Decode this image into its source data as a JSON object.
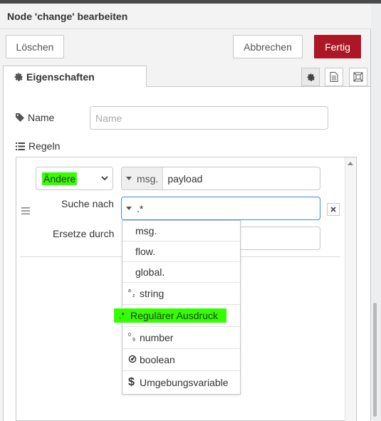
{
  "dialog": {
    "title": "Node 'change' bearbeiten"
  },
  "buttons": {
    "delete": "Löschen",
    "cancel": "Abbrechen",
    "done": "Fertig"
  },
  "tabs": {
    "properties": "Eigenschaften"
  },
  "form": {
    "name_label": "Name",
    "name_placeholder": "Name",
    "name_value": "",
    "rules_label": "Regeln"
  },
  "rule": {
    "action": "Ändere",
    "target_type": "msg.",
    "target_value": "payload",
    "search_label": "Suche nach",
    "search_type": ".*",
    "search_value": "",
    "replace_label": "Ersetze durch"
  },
  "type_menu": [
    {
      "label": "msg.",
      "icon": ""
    },
    {
      "label": "flow.",
      "icon": ""
    },
    {
      "label": "global.",
      "icon": ""
    },
    {
      "label": "string",
      "icon": "az-icon"
    },
    {
      "label": "Regulärer Ausdruck",
      "icon": "regex-icon",
      "highlighted": true
    },
    {
      "label": "number",
      "icon": "09-icon"
    },
    {
      "label": "boolean",
      "icon": "toggle-icon"
    },
    {
      "label": "Umgebungsvariable",
      "icon": "dollar-icon"
    }
  ],
  "colors": {
    "done_button": "#ad1625",
    "highlight": "#33ff00",
    "focus_border": "#3b8bdf"
  }
}
